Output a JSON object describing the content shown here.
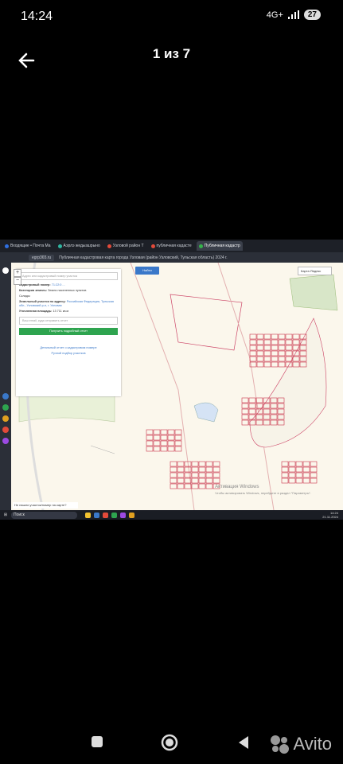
{
  "status": {
    "time": "14:24",
    "network": "4G+",
    "battery": "27"
  },
  "viewer": {
    "counter": "1 из 7"
  },
  "browser": {
    "tabs": [
      {
        "label": "Входящие • Почта Ма",
        "active": false,
        "color": "#2f6fe0"
      },
      {
        "label": "Аэрлэ жедызшрыно",
        "active": false,
        "color": "#2fb5a0"
      },
      {
        "label": "Узловой район Т",
        "active": false,
        "color": "#e24a3a"
      },
      {
        "label": "публичная кадасте",
        "active": false,
        "color": "#e24a3a"
      },
      {
        "label": "Публичная кадастр",
        "active": true,
        "color": "#35b24a"
      }
    ],
    "url": "egrp365.ru",
    "page_title": "Публичная кадастровая карта города Узловая (район Узловский, Тульская область) 2024 г."
  },
  "map": {
    "search_placeholder": "Адрес или кадастровый номер участка",
    "find_button": "Найти",
    "map_type": "Карта Яндекс",
    "panel": {
      "cadastral_label": "Кадастровый номер:",
      "cadastral_value": "71:22:0 ...",
      "category_label": "Категория земель:",
      "category_value": "Земли населенных пунктов",
      "use": "Склады",
      "address_label": "Земельный участок по адресу:",
      "address_value": "Российская Федерация, Тульская обл., Узловский р-н, г. Узловая",
      "area_label": "Уточненная площадь:",
      "area_value": "13 711 кв.м",
      "email_placeholder": "Ваш email, куда отправить отчет",
      "report_button": "Получить подробный отчет",
      "links": [
        "Детальный отчет о кадастровом номере",
        "Ручной подбор участков"
      ]
    },
    "feedback": "Не нашли участок/номер на карте?",
    "watermark_title": "Активация Windows",
    "watermark_sub": "Чтобы активировать Windows, перейдите в раздел \"Параметры\"."
  },
  "taskbar": {
    "search": "Поиск",
    "time": "14:24",
    "date": "21.11.2024"
  }
}
